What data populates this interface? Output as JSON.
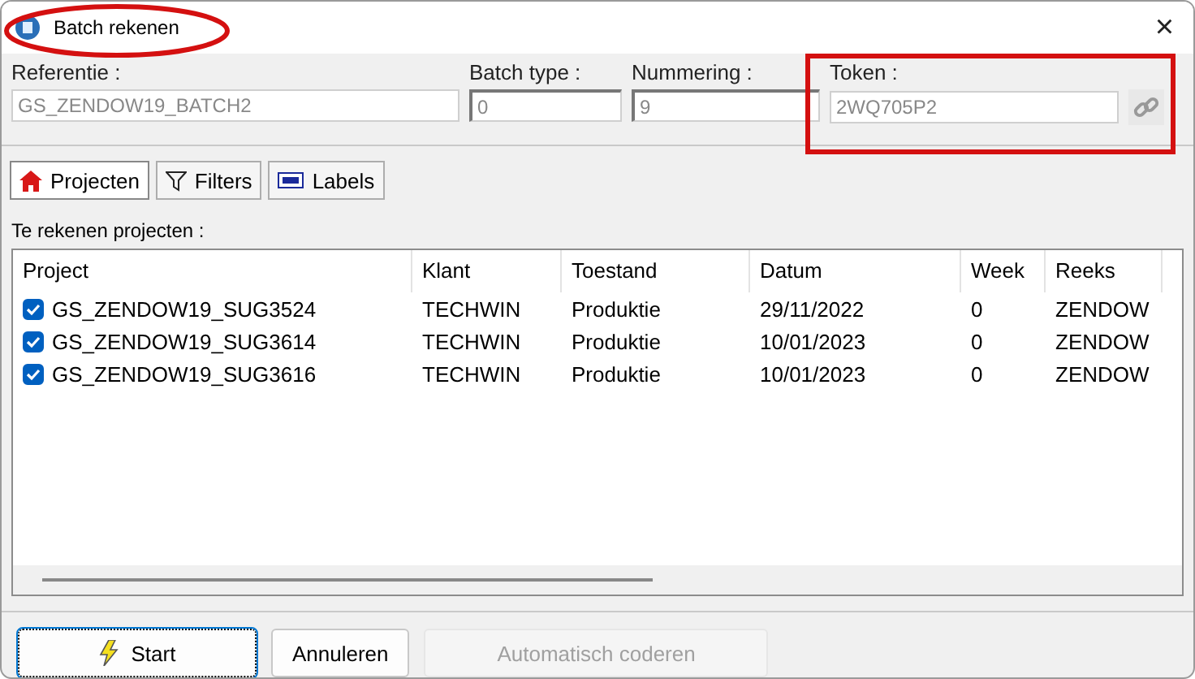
{
  "window": {
    "title": "Batch rekenen",
    "close": "×"
  },
  "fields": [
    {
      "label": "Referentie :",
      "value": "GS_ZENDOW19_BATCH2",
      "kind": "text"
    },
    {
      "label": "Batch type :",
      "value": "0",
      "kind": "text"
    },
    {
      "label": "Nummering :",
      "value": "9",
      "kind": "text"
    },
    {
      "label": "Token :",
      "value": "2WQ705P2",
      "kind": "token"
    }
  ],
  "tabs": [
    {
      "label": "Projecten",
      "selected": true,
      "kind": "home"
    },
    {
      "label": "Filters",
      "selected": false,
      "kind": "filter"
    },
    {
      "label": "Labels",
      "selected": false,
      "kind": "label"
    }
  ],
  "list_title": "Te rekenen projecten :",
  "table": {
    "columns": [
      "Project",
      "Klant",
      "Toestand",
      "Datum",
      "Week",
      "Reeks"
    ],
    "rows": [
      {
        "checked": true,
        "cells": [
          "GS_ZENDOW19_SUG3524",
          "TECHWIN",
          "Produktie",
          "29/11/2022",
          "0",
          "ZENDOW"
        ]
      },
      {
        "checked": true,
        "cells": [
          "GS_ZENDOW19_SUG3614",
          "TECHWIN",
          "Produktie",
          "10/01/2023",
          "0",
          "ZENDOW"
        ]
      },
      {
        "checked": true,
        "cells": [
          "GS_ZENDOW19_SUG3616",
          "TECHWIN",
          "Produktie",
          "10/01/2023",
          "0",
          "ZENDOW"
        ]
      }
    ]
  },
  "buttons": [
    {
      "label": "Start",
      "kind": "start",
      "disabled": false
    },
    {
      "label": "Annuleren",
      "kind": "plain",
      "disabled": false
    },
    {
      "label": "Automatisch coderen",
      "kind": "plain",
      "disabled": true
    }
  ]
}
